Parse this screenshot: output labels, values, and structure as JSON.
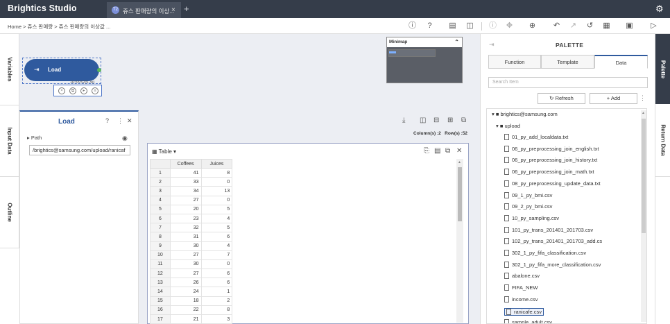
{
  "app": {
    "title": "Brightics Studio"
  },
  "tab": {
    "badge": "T2",
    "label": "쥬스 판매량의 이상...",
    "close": "×",
    "add": "+"
  },
  "breadcrumb": "Home > 쥬스 판매량 > 쥬스 판매량의 이상값 ...",
  "side_tabs": {
    "variables": "Variables",
    "input_data": "Input Data",
    "outline": "Outline"
  },
  "node": {
    "label": "Load",
    "time": "16:55:52(5.3s)"
  },
  "minimap": {
    "title": "Minimap"
  },
  "panel": {
    "title": "Load",
    "path_label": "Path",
    "path_value": "/brightics@samsung.com/upload/ranicaf"
  },
  "result": {
    "columns_label": "Column(s) :2",
    "rows_label": "Row(s) :52",
    "view_label": "Table"
  },
  "table": {
    "columns": [
      "Coffees",
      "Juices"
    ],
    "rows": [
      [
        "1",
        "41",
        "8"
      ],
      [
        "2",
        "33",
        "0"
      ],
      [
        "3",
        "34",
        "13"
      ],
      [
        "4",
        "27",
        "0"
      ],
      [
        "5",
        "20",
        "5"
      ],
      [
        "6",
        "23",
        "4"
      ],
      [
        "7",
        "32",
        "5"
      ],
      [
        "8",
        "31",
        "6"
      ],
      [
        "9",
        "30",
        "4"
      ],
      [
        "10",
        "27",
        "7"
      ],
      [
        "11",
        "30",
        "0"
      ],
      [
        "12",
        "27",
        "6"
      ],
      [
        "13",
        "26",
        "6"
      ],
      [
        "14",
        "24",
        "1"
      ],
      [
        "15",
        "18",
        "2"
      ],
      [
        "16",
        "22",
        "8"
      ],
      [
        "17",
        "21",
        "3"
      ]
    ]
  },
  "palette": {
    "title": "PALETTE",
    "tabs": [
      "Function",
      "Template",
      "Data"
    ],
    "active_tab": "Data",
    "search_placeholder": "Search Item",
    "refresh_label": "Refresh",
    "add_label": "Add",
    "root": "brightics@samsung.com",
    "folder": "upload",
    "files": [
      "01_py_add_localdata.txt",
      "06_py_preprocessing_join_english.txt",
      "06_py_preprocessing_join_history.txt",
      "06_py_preprocessing_join_math.txt",
      "08_py_preprocessing_update_data.txt",
      "09_1_py_bmi.csv",
      "09_2_py_bmi.csv",
      "10_py_sampling.csv",
      "101_py_trans_201401_201703.csv",
      "102_py_trans_201401_201703_add.cs",
      "302_1_py_fifa_classification.csv",
      "302_1_py_fifa_more_classification.csv",
      "abalone.csv",
      "FIFA_NEW",
      "income.csv",
      "ranicafe.csv",
      "sample_adult.csv"
    ],
    "selected_file": "ranicafe.csv"
  },
  "right_tabs": {
    "palette": "Palette",
    "return_data": "Return Data"
  },
  "colors": {
    "topbar": "#353d4a",
    "accent": "#2f5a9e",
    "node": "#2f5a9e"
  }
}
